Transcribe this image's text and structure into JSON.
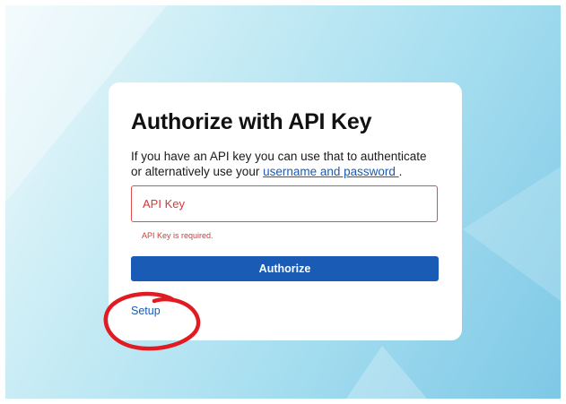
{
  "auth": {
    "title": "Authorize with API Key",
    "description_prefix": "If you have an API key you can use that to authenticate or alternatively use your ",
    "alt_link": "username and password ",
    "description_suffix": ".",
    "api_key_placeholder": "API Key",
    "api_key_value": "",
    "error_message": "API Key is required.",
    "authorize_label": "Authorize",
    "setup_label": "Setup"
  },
  "colors": {
    "primary": "#1a5bb5",
    "error": "#d33a3a",
    "annotation": "#e11b22"
  }
}
